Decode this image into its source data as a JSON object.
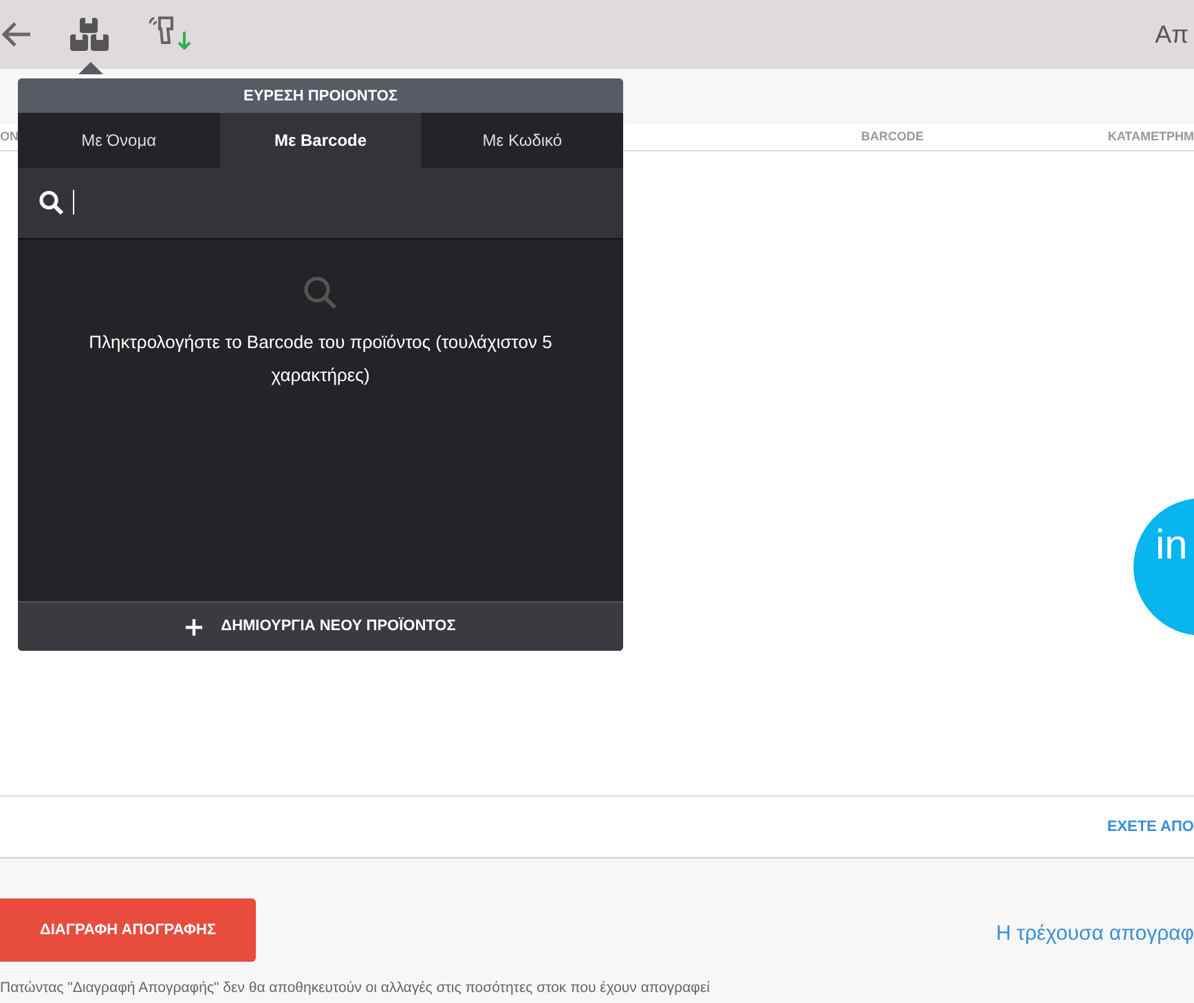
{
  "toolbar": {
    "tools": [
      {
        "kind": "back"
      },
      {
        "kind": "boxes"
      },
      {
        "kind": "scanner"
      }
    ],
    "title": "Απ"
  },
  "table": {
    "columns": [
      "ΟΝ",
      "BARCODE",
      "ΚΑΤΑΜΕΤΡΗΜ"
    ],
    "footer_link": "ΕΧΕΤΕ ΑΠΟ"
  },
  "logo": {
    "text": "in"
  },
  "popup": {
    "title": "ΕΥΡΕΣΗ ΠΡΟΙΟΝΤΟΣ",
    "tabs": [
      {
        "label": "Με Όνομα",
        "selected": false
      },
      {
        "label": "Με Barcode",
        "selected": true
      },
      {
        "label": "Με Κωδικό",
        "selected": false
      }
    ],
    "message": "Πληκτρολογήστε το Barcode του προϊόντος (τουλάχιστον 5 χαρακτήρες)",
    "create_button": "ΔΗΜΙΟΥΡΓΙΑ ΝΕΟΥ ΠΡΟΪΟΝΤΟΣ"
  },
  "delete_button": "ΔΙΑΓΡΑΦΗ ΑΠΟΓΡΑΦΗΣ",
  "status_link": "Η τρέχουσα απογραφ",
  "note": "Πατώντας \"Διαγραφή Απογραφής\" δεν θα αποθηκευτούν οι αλλαγές στις ποσότητες στοκ που έχουν απογραφεί"
}
